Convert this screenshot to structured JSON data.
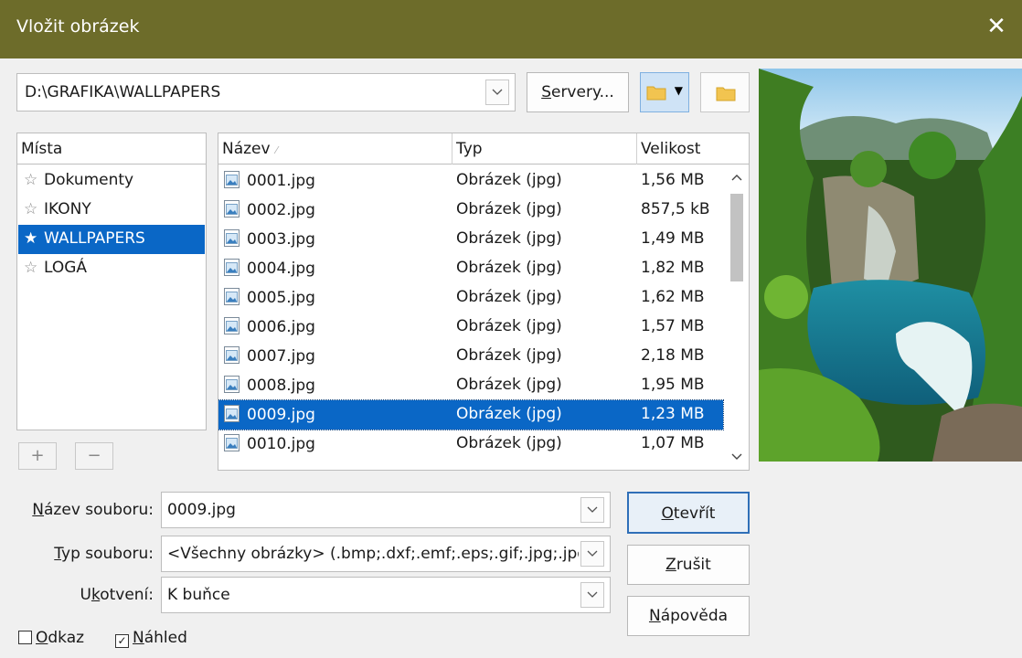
{
  "window": {
    "title": "Vložit obrázek",
    "close_glyph": "✕"
  },
  "path_bar": {
    "path": "D:\\GRAFIKA\\WALLPAPERS",
    "servers_button": {
      "prefix": "",
      "accel": "S",
      "rest": "ervery..."
    }
  },
  "places": {
    "header": "Místa",
    "items": [
      {
        "label": "Dokumenty",
        "selected": false
      },
      {
        "label": "IKONY",
        "selected": false
      },
      {
        "label": "WALLPAPERS",
        "selected": true
      },
      {
        "label": "LOGÁ",
        "selected": false
      }
    ],
    "add_label": "+",
    "remove_label": "−"
  },
  "files": {
    "columns": {
      "name": "Název",
      "type": "Typ",
      "size": "Velikost"
    },
    "rows": [
      {
        "name": "0001.jpg",
        "type": "Obrázek (jpg)",
        "size": "1,56 MB"
      },
      {
        "name": "0002.jpg",
        "type": "Obrázek (jpg)",
        "size": "857,5 kB"
      },
      {
        "name": "0003.jpg",
        "type": "Obrázek (jpg)",
        "size": "1,49 MB"
      },
      {
        "name": "0004.jpg",
        "type": "Obrázek (jpg)",
        "size": "1,82 MB"
      },
      {
        "name": "0005.jpg",
        "type": "Obrázek (jpg)",
        "size": "1,62 MB"
      },
      {
        "name": "0006.jpg",
        "type": "Obrázek (jpg)",
        "size": "1,57 MB"
      },
      {
        "name": "0007.jpg",
        "type": "Obrázek (jpg)",
        "size": "2,18 MB"
      },
      {
        "name": "0008.jpg",
        "type": "Obrázek (jpg)",
        "size": "1,95 MB"
      },
      {
        "name": "0009.jpg",
        "type": "Obrázek (jpg)",
        "size": "1,23 MB"
      },
      {
        "name": "0010.jpg",
        "type": "Obrázek (jpg)",
        "size": "1,07 MB"
      }
    ],
    "selected_index": 8
  },
  "form": {
    "filename_label": {
      "accel": "N",
      "rest": "ázev souboru:"
    },
    "filename_value": "0009.jpg",
    "filetype_label": {
      "accel": "T",
      "rest": "yp souboru:"
    },
    "filetype_value": "<Všechny obrázky> (.bmp;.dxf;.emf;.eps;.gif;.jpg;.jpeg;.png;.svg;.tif)",
    "anchor_label": {
      "prefix": "U",
      "accel": "k",
      "rest": "otvení:"
    },
    "anchor_value": "K buňce"
  },
  "buttons": {
    "open": {
      "accel": "O",
      "rest": "tevřít"
    },
    "cancel": {
      "accel": "Z",
      "rest": "rušit"
    },
    "help": {
      "accel": "N",
      "rest": "ápověda"
    }
  },
  "checkboxes": {
    "link": {
      "accel": "O",
      "rest": "dkaz",
      "checked": false
    },
    "preview": {
      "accel": "N",
      "rest": "áhled",
      "checked": true
    }
  },
  "colors": {
    "titlebar": "#6d6c2a",
    "selection": "#0a67c6",
    "folder": "#f2c450"
  }
}
